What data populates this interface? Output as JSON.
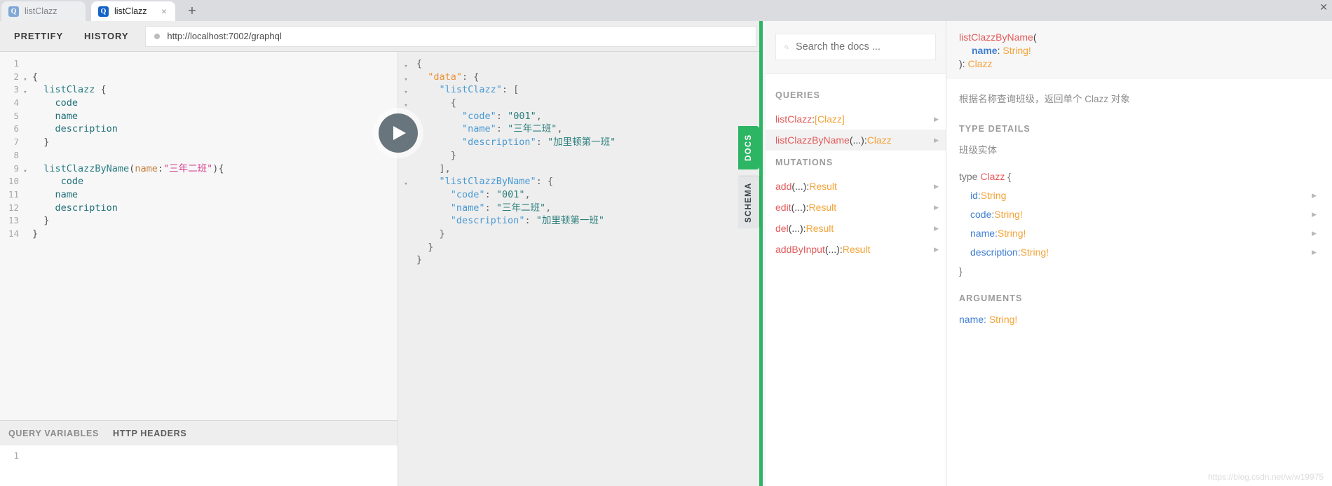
{
  "browser": {
    "tabs": [
      {
        "title": "listClazz",
        "favicon": "graphql-q-icon",
        "active": false
      },
      {
        "title": "listClazz",
        "favicon": "graphql-q-icon",
        "active": true
      }
    ],
    "new_tab_label": "+",
    "close_label": "×",
    "window_close_label": "✕"
  },
  "toolbar": {
    "prettify_label": "PRETTIFY",
    "history_label": "HISTORY",
    "url": "http://localhost:7002/graphql"
  },
  "query_editor": {
    "lines": [
      {
        "n": "1",
        "fold": "",
        "segs": []
      },
      {
        "n": "2",
        "fold": "▾",
        "segs": [
          {
            "t": "{",
            "c": "k-punc"
          }
        ]
      },
      {
        "n": "3",
        "fold": "▾",
        "segs": [
          {
            "t": "  listClazz ",
            "c": "k-def"
          },
          {
            "t": "{",
            "c": "k-punc"
          }
        ]
      },
      {
        "n": "4",
        "fold": "",
        "segs": [
          {
            "t": "    code",
            "c": "k-field"
          }
        ]
      },
      {
        "n": "5",
        "fold": "",
        "segs": [
          {
            "t": "    name",
            "c": "k-field"
          }
        ]
      },
      {
        "n": "6",
        "fold": "",
        "segs": [
          {
            "t": "    description",
            "c": "k-field"
          }
        ]
      },
      {
        "n": "7",
        "fold": "",
        "segs": [
          {
            "t": "  }",
            "c": "k-punc"
          }
        ]
      },
      {
        "n": "8",
        "fold": "",
        "segs": []
      },
      {
        "n": "9",
        "fold": "▾",
        "segs": [
          {
            "t": "  listClazzByName",
            "c": "k-def"
          },
          {
            "t": "(",
            "c": "k-punc"
          },
          {
            "t": "name",
            "c": "k-arg"
          },
          {
            "t": ":",
            "c": "k-punc"
          },
          {
            "t": "\"三年二班\"",
            "c": "k-str"
          },
          {
            "t": "){",
            "c": "k-punc"
          }
        ]
      },
      {
        "n": "10",
        "fold": "",
        "segs": [
          {
            "t": "     code",
            "c": "k-field"
          }
        ]
      },
      {
        "n": "11",
        "fold": "",
        "segs": [
          {
            "t": "    name",
            "c": "k-field"
          }
        ]
      },
      {
        "n": "12",
        "fold": "",
        "segs": [
          {
            "t": "    description",
            "c": "k-field"
          }
        ]
      },
      {
        "n": "13",
        "fold": "",
        "segs": [
          {
            "t": "  }",
            "c": "k-punc"
          }
        ]
      },
      {
        "n": "14",
        "fold": "",
        "segs": [
          {
            "t": "}",
            "c": "k-punc"
          }
        ]
      }
    ]
  },
  "result_viewer": {
    "lines": [
      {
        "fold": "▾",
        "segs": [
          {
            "t": "{",
            "c": "r-punc"
          }
        ]
      },
      {
        "fold": "▾",
        "segs": [
          {
            "t": "  ",
            "c": "r-punc"
          },
          {
            "t": "\"data\"",
            "c": "r-keyo"
          },
          {
            "t": ": {",
            "c": "r-punc"
          }
        ]
      },
      {
        "fold": "▾",
        "segs": [
          {
            "t": "    ",
            "c": "r-punc"
          },
          {
            "t": "\"listClazz\"",
            "c": "r-key"
          },
          {
            "t": ": [",
            "c": "r-punc"
          }
        ]
      },
      {
        "fold": "▾",
        "segs": [
          {
            "t": "      {",
            "c": "r-punc"
          }
        ]
      },
      {
        "fold": "",
        "segs": [
          {
            "t": "        ",
            "c": "r-punc"
          },
          {
            "t": "\"code\"",
            "c": "r-key"
          },
          {
            "t": ": ",
            "c": "r-punc"
          },
          {
            "t": "\"001\"",
            "c": "r-str"
          },
          {
            "t": ",",
            "c": "r-punc"
          }
        ]
      },
      {
        "fold": "",
        "segs": [
          {
            "t": "        ",
            "c": "r-punc"
          },
          {
            "t": "\"name\"",
            "c": "r-key"
          },
          {
            "t": ": ",
            "c": "r-punc"
          },
          {
            "t": "\"三年二班\"",
            "c": "r-str"
          },
          {
            "t": ",",
            "c": "r-punc"
          }
        ]
      },
      {
        "fold": "",
        "segs": [
          {
            "t": "        ",
            "c": "r-punc"
          },
          {
            "t": "\"description\"",
            "c": "r-key"
          },
          {
            "t": ": ",
            "c": "r-punc"
          },
          {
            "t": "\"加里顿第一班\"",
            "c": "r-str"
          }
        ]
      },
      {
        "fold": "",
        "segs": [
          {
            "t": "      }",
            "c": "r-punc"
          }
        ]
      },
      {
        "fold": "",
        "segs": [
          {
            "t": "    ],",
            "c": "r-punc"
          }
        ]
      },
      {
        "fold": "▾",
        "segs": [
          {
            "t": "    ",
            "c": "r-punc"
          },
          {
            "t": "\"listClazzByName\"",
            "c": "r-key"
          },
          {
            "t": ": {",
            "c": "r-punc"
          }
        ]
      },
      {
        "fold": "",
        "segs": [
          {
            "t": "      ",
            "c": "r-punc"
          },
          {
            "t": "\"code\"",
            "c": "r-key"
          },
          {
            "t": ": ",
            "c": "r-punc"
          },
          {
            "t": "\"001\"",
            "c": "r-str"
          },
          {
            "t": ",",
            "c": "r-punc"
          }
        ]
      },
      {
        "fold": "",
        "segs": [
          {
            "t": "      ",
            "c": "r-punc"
          },
          {
            "t": "\"name\"",
            "c": "r-key"
          },
          {
            "t": ": ",
            "c": "r-punc"
          },
          {
            "t": "\"三年二班\"",
            "c": "r-str"
          },
          {
            "t": ",",
            "c": "r-punc"
          }
        ]
      },
      {
        "fold": "",
        "segs": [
          {
            "t": "      ",
            "c": "r-punc"
          },
          {
            "t": "\"description\"",
            "c": "r-key"
          },
          {
            "t": ": ",
            "c": "r-punc"
          },
          {
            "t": "\"加里顿第一班\"",
            "c": "r-str"
          }
        ]
      },
      {
        "fold": "",
        "segs": [
          {
            "t": "    }",
            "c": "r-punc"
          }
        ]
      },
      {
        "fold": "",
        "segs": [
          {
            "t": "  }",
            "c": "r-punc"
          }
        ]
      },
      {
        "fold": "",
        "segs": [
          {
            "t": "}",
            "c": "r-punc"
          }
        ]
      }
    ]
  },
  "execute_button": {
    "label": "execute-query",
    "color": "#68757c"
  },
  "bottom_bar": {
    "query_variables_label": "QUERY VARIABLES",
    "http_headers_label": "HTTP HEADERS",
    "variables_line_number": "1"
  },
  "side_handles": {
    "docs_label": "DOCS",
    "schema_label": "SCHEMA",
    "docs_color": "#2cb563"
  },
  "docs_explorer": {
    "search_placeholder": "Search the docs ...",
    "sections": [
      {
        "title": "QUERIES",
        "items": [
          {
            "name": "listClazz",
            "args": "",
            "sep": ": ",
            "type": "[Clazz]",
            "selected": false
          },
          {
            "name": "listClazzByName",
            "args": "(...)",
            "sep": ": ",
            "type": "Clazz",
            "selected": true
          }
        ]
      },
      {
        "title": "MUTATIONS",
        "items": [
          {
            "name": "add",
            "args": "(...)",
            "sep": ": ",
            "type": "Result",
            "selected": false
          },
          {
            "name": "edit",
            "args": "(...)",
            "sep": ": ",
            "type": "Result",
            "selected": false
          },
          {
            "name": "del",
            "args": "(...)",
            "sep": ": ",
            "type": "Result",
            "selected": false
          },
          {
            "name": "addByInput",
            "args": "(...)",
            "sep": ": ",
            "type": "Result",
            "selected": false
          }
        ]
      }
    ]
  },
  "docs_detail": {
    "signature": {
      "field_name": "listClazzByName",
      "open_paren": "(",
      "arg_name": "name",
      "arg_sep": ": ",
      "arg_type": "String!",
      "close_paren": "): ",
      "return_type": "Clazz"
    },
    "description": "根据名称查询班级，返回单个 Clazz 对象",
    "type_details_title": "TYPE DETAILS",
    "type_description": "班级实体",
    "type_keyword": "type ",
    "type_name": "Clazz",
    "brace_open": " {",
    "brace_close": "}",
    "fields": [
      {
        "name": "id",
        "sep": ": ",
        "type": "String"
      },
      {
        "name": "code",
        "sep": ": ",
        "type": "String!"
      },
      {
        "name": "name",
        "sep": ": ",
        "type": "String!"
      },
      {
        "name": "description",
        "sep": ": ",
        "type": "String!"
      }
    ],
    "arguments_title": "ARGUMENTS",
    "arguments": [
      {
        "name": "name",
        "sep": ": ",
        "type": "String!"
      }
    ],
    "watermark": "https://blog.csdn.net/w/w19975"
  }
}
